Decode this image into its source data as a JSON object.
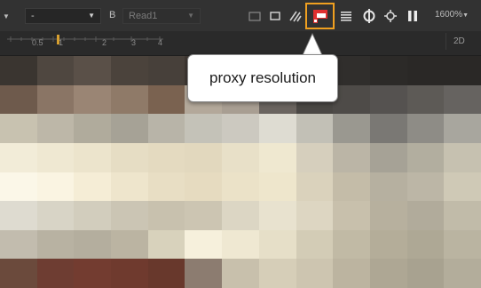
{
  "toolbar": {
    "left_arrow_icon": "chevron-down-icon",
    "layer_dropdown": {
      "value": "-"
    },
    "channel_label": "B",
    "node_field": {
      "value": "Read1"
    },
    "icons": [
      "roi-icon",
      "region-box-icon",
      "clipping-warning-icon",
      "proxy-resolution-icon",
      "lines-menu-icon",
      "sync-icon",
      "settings-gear-icon",
      "pause-icon"
    ],
    "zoom_label": "1600%",
    "accent_color": "#f0a020",
    "proxy_icon_color": "#e03030"
  },
  "ruler": {
    "labels": [
      "0.5",
      "1",
      "2",
      "3",
      "4"
    ],
    "mode_label": "2D"
  },
  "tooltip": {
    "text": "proxy resolution"
  },
  "pixel_colors": [
    [
      "#3a3530",
      "#4f4740",
      "#5a5048",
      "#4b433c",
      "#47403a",
      "#3f3833",
      "#3a3531",
      "#3a3630",
      "#353230",
      "#302e2c",
      "#2c2a28",
      "#2a2826",
      "#2a2826"
    ],
    [
      "#6e5a4c",
      "#8a7565",
      "#9a8574",
      "#8f7a68",
      "#7a6250",
      "#b3a89a",
      "#a89e92",
      "#6a645f",
      "#4a4744",
      "#4e4b48",
      "#555250",
      "#5d5a56",
      "#666360"
    ],
    [
      "#c8c2b0",
      "#bdb7a8",
      "#b0ab9c",
      "#a6a296",
      "#b8b4a8",
      "#c4c2b8",
      "#ccc9c0",
      "#dedcd2",
      "#c2c0b6",
      "#9a9890",
      "#7a7874",
      "#8e8c86",
      "#a8a69e"
    ],
    [
      "#f2ecd8",
      "#efe8d2",
      "#ece4cc",
      "#e6ddc4",
      "#e4dac0",
      "#e2d8be",
      "#e8e0c8",
      "#efe8d0",
      "#d6cfbd",
      "#bbb5a6",
      "#a6a296",
      "#b2ae9f",
      "#c6c1b0"
    ],
    [
      "#fbf7e8",
      "#faf4e2",
      "#f5edd6",
      "#eee5cc",
      "#e8dec4",
      "#e6dbc0",
      "#ebe2c8",
      "#eee6cc",
      "#dad2bc",
      "#c4bca8",
      "#b6b0a0",
      "#bcb6a6",
      "#cfc9b6"
    ],
    [
      "#dedbd0",
      "#d8d4c6",
      "#d2cdbd",
      "#cbc5b4",
      "#c8c1ae",
      "#ccc5b2",
      "#dcd6c4",
      "#e8e2cf",
      "#ddd6c2",
      "#c8c0ac",
      "#b7b09e",
      "#b1ab9b",
      "#c1bba9"
    ],
    [
      "#c2bcae",
      "#b8b2a2",
      "#b4ae9e",
      "#bbb4a2",
      "#d8d2bc",
      "#f6f0dc",
      "#efe8d2",
      "#e6dfc8",
      "#d3ccb6",
      "#c1baa5",
      "#b4ad99",
      "#aea895",
      "#bab4a1"
    ],
    [
      "#6b4a3c",
      "#6e3d32",
      "#733c30",
      "#6f3a2e",
      "#68382c",
      "#8c7c70",
      "#c8c0ac",
      "#d6ceb8",
      "#cdc5b0",
      "#bcb4a0",
      "#aea794",
      "#a8a290",
      "#b3ad9b"
    ]
  ]
}
